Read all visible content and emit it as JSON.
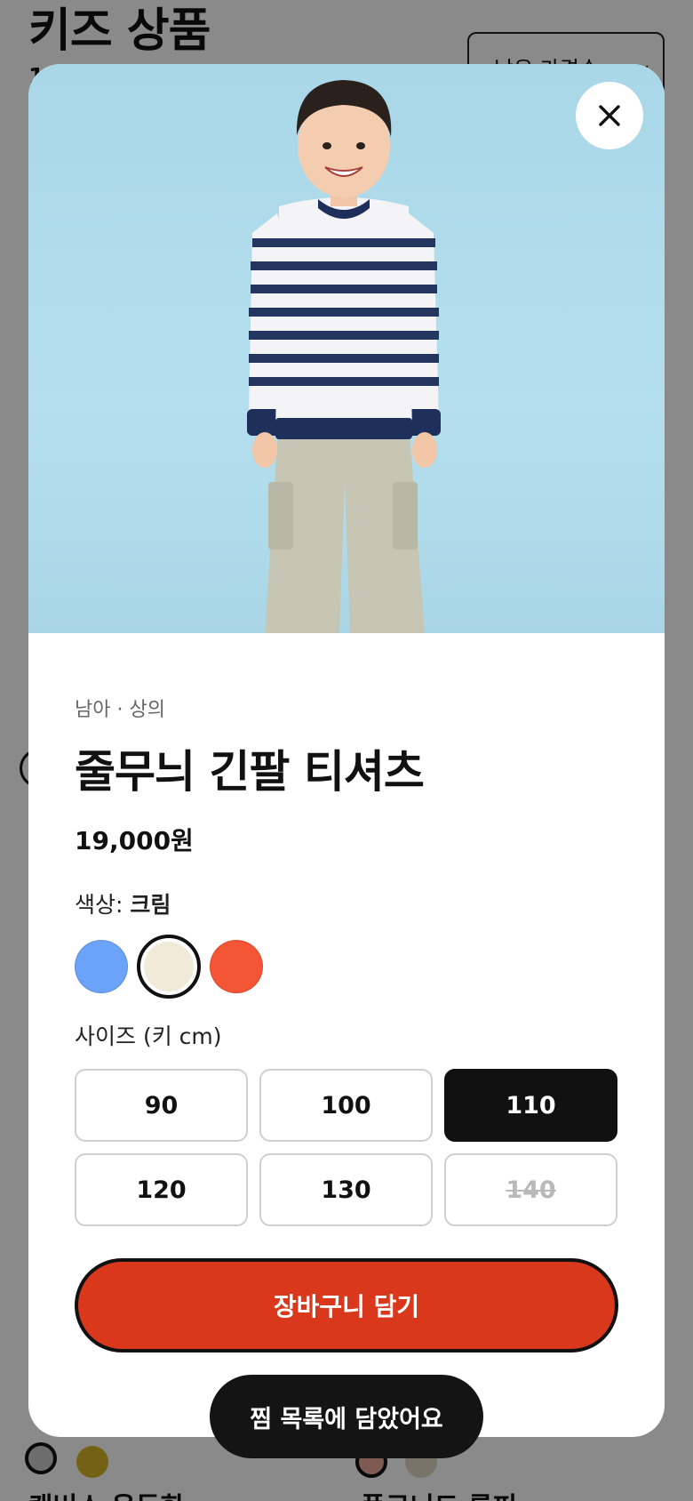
{
  "background": {
    "page_title": "키즈 상품",
    "count_text": "1",
    "sort_label": "낮은 가격순",
    "card_left_name": "캔버스 운동화",
    "card_right_name": "플로니드 롤피",
    "dot_colors": [
      "#c9c9c9",
      "#d9b42a",
      "#e7a998",
      "#ded6c4"
    ]
  },
  "modal": {
    "category": "남아 · 상의",
    "product_name": "줄무늬 긴팔 티셔츠",
    "price": "19,000원",
    "color_label": "색상:",
    "color_selected": "크림",
    "colors": [
      {
        "name": "blue",
        "hex": "#6aa3f8"
      },
      {
        "name": "cream",
        "hex": "#f2ead9"
      },
      {
        "name": "red",
        "hex": "#f45535"
      }
    ],
    "size_label": "사이즈 (키 cm)",
    "sizes": [
      "90",
      "100",
      "110",
      "120",
      "130",
      "140"
    ],
    "selected_size": "110",
    "soldout_size": "140",
    "cart_button": "장바구니 담기"
  },
  "toast": {
    "text": "찜 목록에 담았어요"
  }
}
